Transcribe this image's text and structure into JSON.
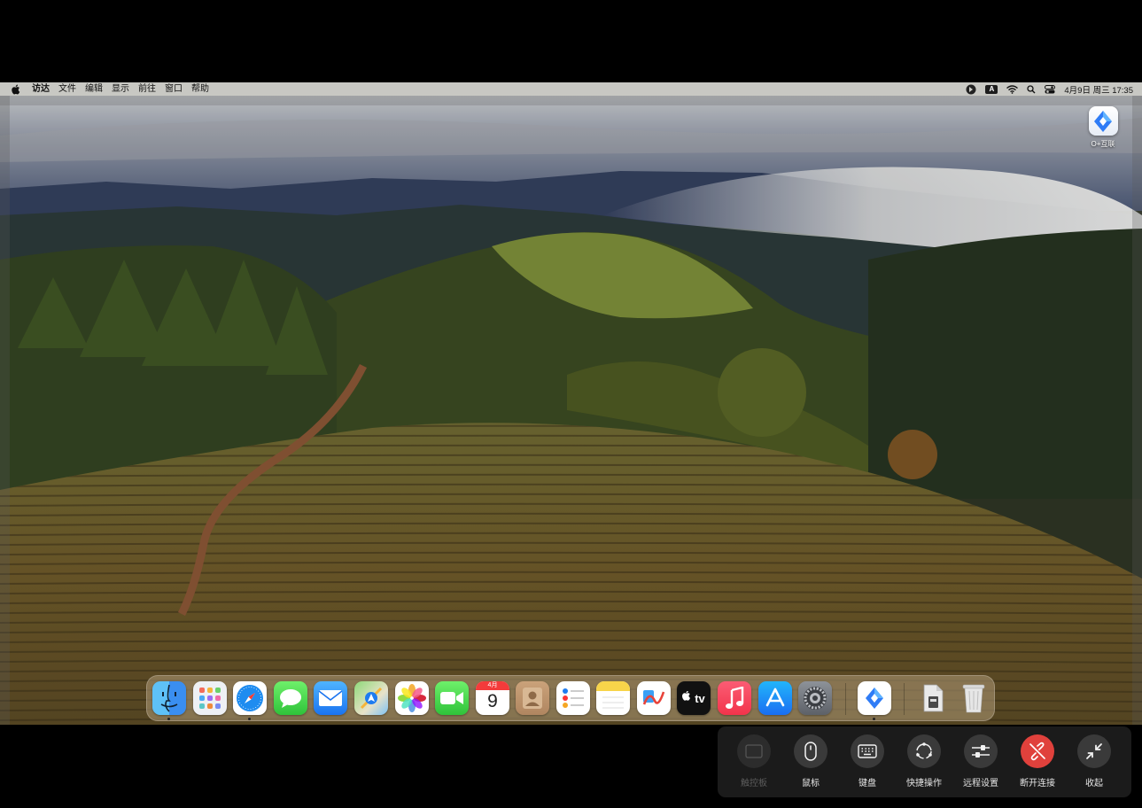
{
  "menubar": {
    "apple_icon": "apple-icon",
    "app_name": "访达",
    "menus": [
      "文件",
      "编辑",
      "显示",
      "前往",
      "窗口",
      "帮助"
    ],
    "status_icons": [
      "toolbox-icon",
      "input-source-icon",
      "wifi-icon",
      "search-icon",
      "control-center-icon"
    ],
    "input_source": "A",
    "clock": "4月9日 周三 17:35"
  },
  "desktop": {
    "items": [
      {
        "label": "O+互联",
        "icon": "oplus-connect-app-icon"
      }
    ]
  },
  "dock": {
    "apps": [
      {
        "name": "finder",
        "running": true
      },
      {
        "name": "launchpad",
        "running": false
      },
      {
        "name": "safari",
        "running": true
      },
      {
        "name": "messages",
        "running": false
      },
      {
        "name": "mail",
        "running": false
      },
      {
        "name": "maps",
        "running": false
      },
      {
        "name": "photos",
        "running": false
      },
      {
        "name": "facetime",
        "running": false
      },
      {
        "name": "calendar",
        "running": false,
        "month": "4月",
        "day": "9"
      },
      {
        "name": "contacts",
        "running": false
      },
      {
        "name": "reminders",
        "running": false
      },
      {
        "name": "notes",
        "running": false
      },
      {
        "name": "freeform",
        "running": false
      },
      {
        "name": "apple-tv",
        "running": false,
        "text": "tv"
      },
      {
        "name": "music",
        "running": false
      },
      {
        "name": "app-store",
        "running": false
      },
      {
        "name": "system-settings",
        "running": false
      },
      {
        "name": "oplus-connect",
        "running": true
      },
      {
        "name": "downloads-stack",
        "running": false
      },
      {
        "name": "trash",
        "running": false
      }
    ]
  },
  "toolbar": {
    "buttons": [
      {
        "id": "touchpad",
        "label": "触控板",
        "icon": "touchpad-icon",
        "disabled": true
      },
      {
        "id": "mouse",
        "label": "鼠标",
        "icon": "mouse-icon"
      },
      {
        "id": "keyboard",
        "label": "键盘",
        "icon": "keyboard-icon"
      },
      {
        "id": "quick-actions",
        "label": "快捷操作",
        "icon": "quick-actions-icon"
      },
      {
        "id": "remote-settings",
        "label": "远程设置",
        "icon": "sliders-icon"
      },
      {
        "id": "disconnect",
        "label": "断开连接",
        "icon": "disconnect-icon",
        "danger": true
      },
      {
        "id": "collapse",
        "label": "收起",
        "icon": "collapse-icon"
      }
    ]
  },
  "colors": {
    "disconnect": "#e0413c",
    "toolbar_bg": "#1b1b1b",
    "menubar_bg": "#cdcdc8"
  }
}
